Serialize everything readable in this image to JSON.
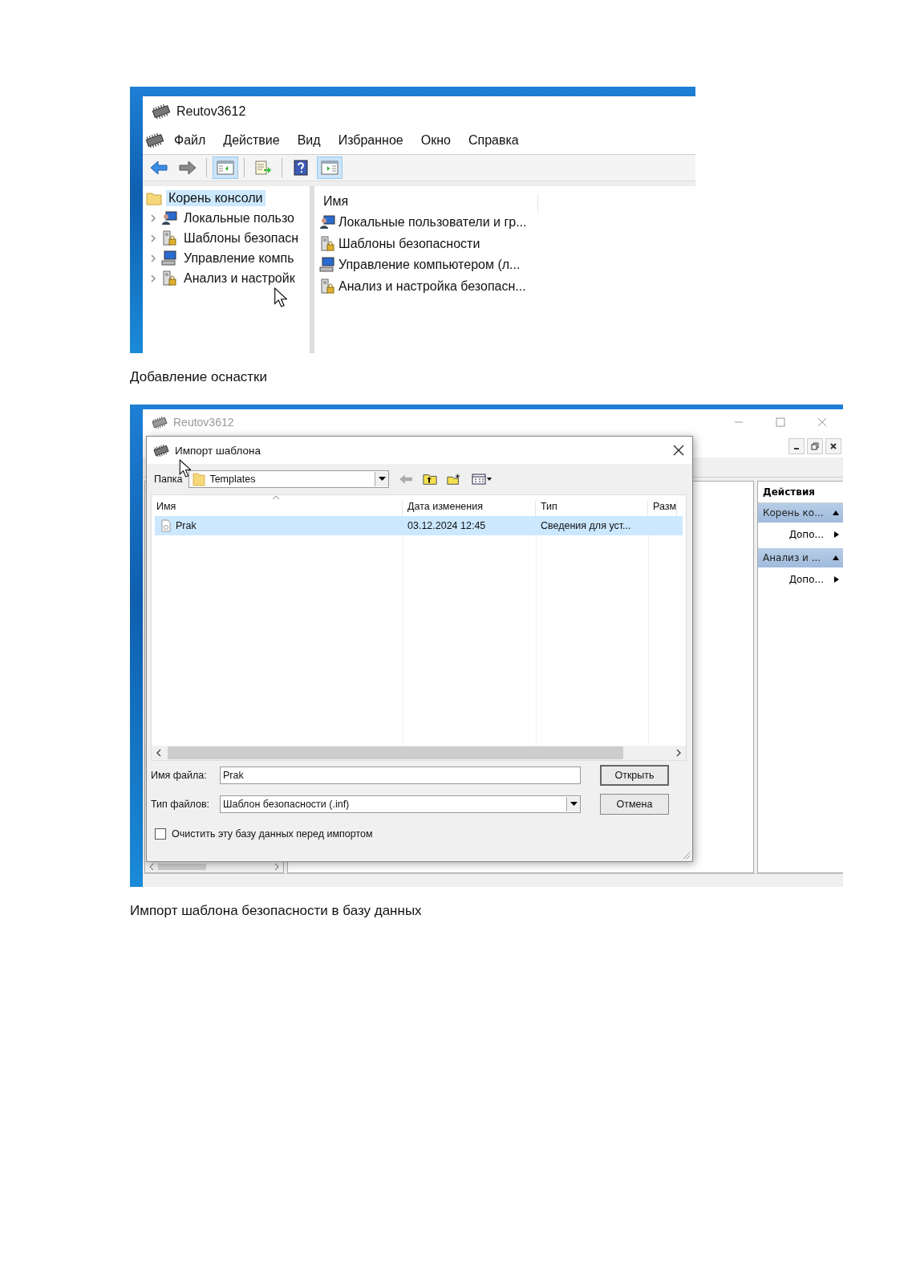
{
  "snapin_window": {
    "title": "Reutov3612",
    "menu": [
      "Файл",
      "Действие",
      "Вид",
      "Избранное",
      "Окно",
      "Справка"
    ],
    "toolbar": [
      {
        "buttons": [
          {
            "kind": "back",
            "pressed": false
          },
          {
            "kind": "forward",
            "pressed": false
          }
        ]
      },
      {
        "buttons": [
          {
            "kind": "tree",
            "pressed": true
          }
        ]
      },
      {
        "buttons": [
          {
            "kind": "export",
            "pressed": false
          }
        ]
      },
      {
        "buttons": [
          {
            "kind": "help",
            "pressed": false
          },
          {
            "kind": "actions",
            "pressed": true
          }
        ]
      }
    ],
    "tree": [
      {
        "label": "Корень консоли",
        "kind": "folder",
        "selected": true,
        "children": [
          {
            "label": "Локальные пользо",
            "kind": "users",
            "expanded": false,
            "selected": false
          },
          {
            "label": "Шаблоны безопасн",
            "kind": "template",
            "expanded": false,
            "selected": false
          },
          {
            "label": "Управление компь",
            "kind": "computer",
            "expanded": false,
            "selected": false
          },
          {
            "label": "Анализ и настройк",
            "kind": "template",
            "expanded": false,
            "selected": false
          }
        ]
      }
    ],
    "list": {
      "columns": [
        "Имя"
      ],
      "rows": [
        {
          "name": "Локальные пользователи и гр...",
          "kind": "users"
        },
        {
          "name": "Шаблоны безопасности",
          "kind": "template"
        },
        {
          "name": "Управление компьютером (л...",
          "kind": "computer"
        },
        {
          "name": "Анализ и настройка безопасн...",
          "kind": "template"
        }
      ]
    }
  },
  "caption_1": "Добавление оснастки",
  "background_window": {
    "title": "Reutov3612",
    "actions": {
      "title": "Действия",
      "groups": [
        {
          "label": "Корень ко...",
          "expanded": true,
          "items": [
            "Допо..."
          ]
        },
        {
          "label": "Анализ и ...",
          "expanded": true,
          "items": [
            "Допо..."
          ]
        }
      ]
    }
  },
  "dialog": {
    "title": "Импорт шаблона",
    "folder_label": "Папка",
    "folder": "Templates",
    "columns": [
      "Имя",
      "Дата изменения",
      "Тип",
      "Разм"
    ],
    "rows": [
      {
        "name": "Prak",
        "date": "03.12.2024 12:45",
        "type": "Сведения для уст...",
        "selected": true
      }
    ],
    "file_name_label": "Имя файла:",
    "file_name": "Prak",
    "file_type_label": "Тип файлов:",
    "file_type": "Шаблон безопасности (.inf)",
    "buttons": [
      "Открыть",
      "Отмена"
    ],
    "clear_db": {
      "label": "Очистить эту базу данных перед импортом",
      "checked": false
    }
  },
  "caption_2": "Импорт шаблона безопасности в базу данных"
}
